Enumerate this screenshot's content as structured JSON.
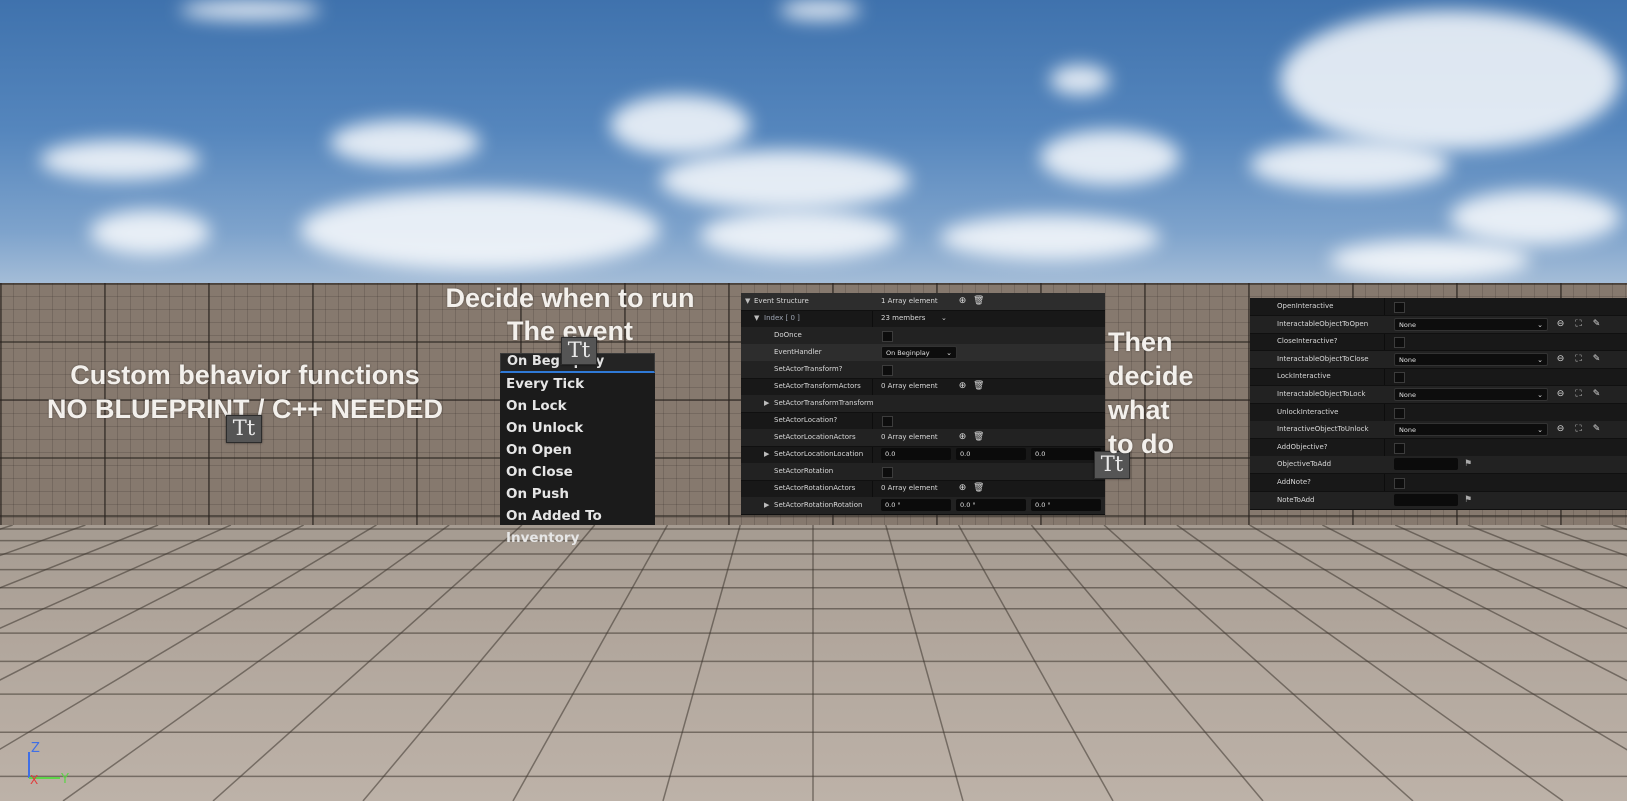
{
  "wall_texts": {
    "left_line1": "Custom behavior functions",
    "left_line2": "NO BLUEPRINT / C++ NEEDED",
    "middle_line1": "Decide when to run",
    "middle_line2": "The event",
    "right_line1": "Then",
    "right_line2": "decide",
    "right_line3": "what",
    "right_line4": "to do"
  },
  "text_actor_icon": "Tt",
  "dropdown": {
    "selected": "On Beginplay",
    "options": [
      "Every Tick",
      "On Lock",
      "On Unlock",
      "On Open",
      "On Close",
      "On Push",
      "On Added To Inventory"
    ]
  },
  "event_panel": {
    "header_label": "Event Structure",
    "header_value": "1 Array element",
    "index_label": "Index [ 0 ]",
    "index_value": "23 members",
    "rows": [
      {
        "label": "DoOnce"
      },
      {
        "label": "EventHandler",
        "value": "On Beginplay"
      },
      {
        "label": "SetActorTransform?"
      },
      {
        "label": "SetActorTransformActors",
        "value": "0 Array element"
      },
      {
        "label": "SetActorTransformTransform"
      },
      {
        "label": "SetActorLocation?"
      },
      {
        "label": "SetActorLocationActors",
        "value": "0 Array element"
      },
      {
        "label": "SetActorLocationLocation",
        "x": "0.0",
        "y": "0.0",
        "z": "0.0"
      },
      {
        "label": "SetActorRotation"
      },
      {
        "label": "SetActorRotationActors",
        "value": "0 Array element"
      },
      {
        "label": "SetActorRotationRotation",
        "x": "0.0 °",
        "y": "0.0 °",
        "z": "0.0 °"
      }
    ]
  },
  "interact_panel": {
    "rows": [
      {
        "label": "OpenInteractive"
      },
      {
        "label": "InteractableObjectToOpen",
        "value": "None"
      },
      {
        "label": "CloseInteractive?"
      },
      {
        "label": "InteractableObjectToClose",
        "value": "None"
      },
      {
        "label": "LockInteractive"
      },
      {
        "label": "InteractableObjectToLock",
        "value": "None"
      },
      {
        "label": "UnlockInteractive"
      },
      {
        "label": "InteractiveObjectToUnlock",
        "value": "None"
      },
      {
        "label": "AddObjective?"
      },
      {
        "label": "ObjectiveToAdd"
      },
      {
        "label": "AddNote?"
      },
      {
        "label": "NoteToAdd"
      }
    ]
  },
  "gizmo": {
    "z": "Z",
    "x": "X",
    "y": "Y"
  },
  "colors": {
    "accent": "#2f79d6",
    "gizmo_x": "#e23b3b",
    "gizmo_y": "#5fd44a",
    "gizmo_z": "#3f6fe6"
  }
}
